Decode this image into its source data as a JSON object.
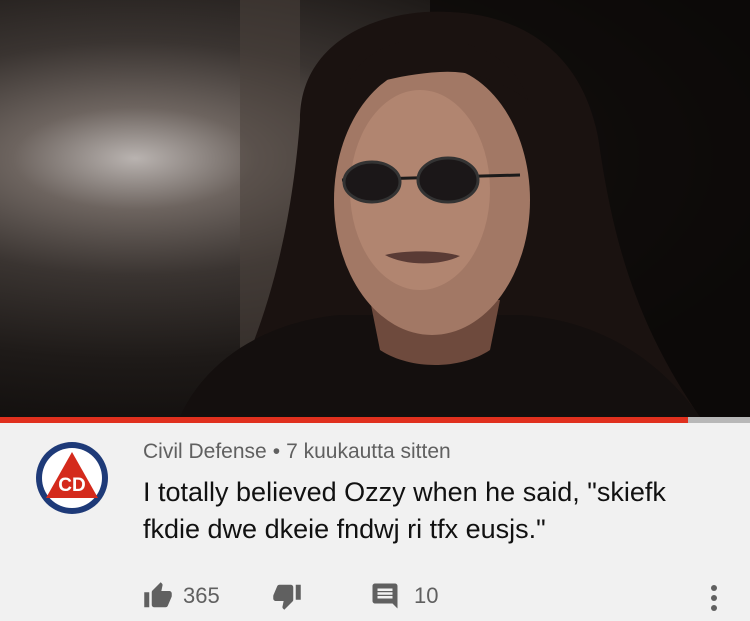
{
  "video": {
    "progress_fraction": 0.917
  },
  "comment": {
    "author": "Civil Defense",
    "separator": "•",
    "timestamp": "7 kuukautta sitten",
    "text": "I totally believed Ozzy when he said, \"skiefk fkdie dwe dkeie fndwj ri tfx eusjs.\"",
    "avatar_letters": "CD",
    "likes": "365",
    "replies": "10"
  },
  "icons": {
    "like": "thumbs-up-icon",
    "dislike": "thumbs-down-icon",
    "reply": "comment-icon",
    "menu": "more-vertical-icon"
  },
  "colors": {
    "progress": "#e0301e",
    "avatar_circle": "#1e3a78",
    "avatar_triangle": "#d42a1c"
  }
}
